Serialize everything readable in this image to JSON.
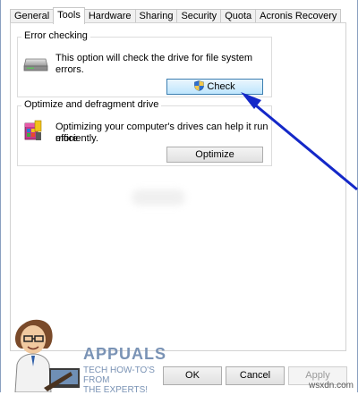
{
  "tabs": [
    "General",
    "Tools",
    "Hardware",
    "Sharing",
    "Security",
    "Quota",
    "Acronis Recovery"
  ],
  "active_tab": "Tools",
  "error_checking": {
    "title": "Error checking",
    "description_line1": "This option will check the drive for file system",
    "description_line2": "errors.",
    "button_label": "Check"
  },
  "optimize": {
    "title": "Optimize and defragment drive",
    "description_line1": "Optimizing your computer's drives can help it run more",
    "description_line2": "efficiently.",
    "button_label": "Optimize"
  },
  "footer": {
    "ok_label": "OK",
    "cancel_label": "Cancel",
    "apply_label": "Apply"
  },
  "branding": {
    "logo_main": "APPUALS",
    "logo_line1": "TECH HOW-TO'S FROM",
    "logo_line2": "THE EXPERTS!",
    "watermark": "wsxdn.com"
  },
  "colors": {
    "arrow": "#1428c8",
    "focus_border": "#3c7fb1"
  }
}
